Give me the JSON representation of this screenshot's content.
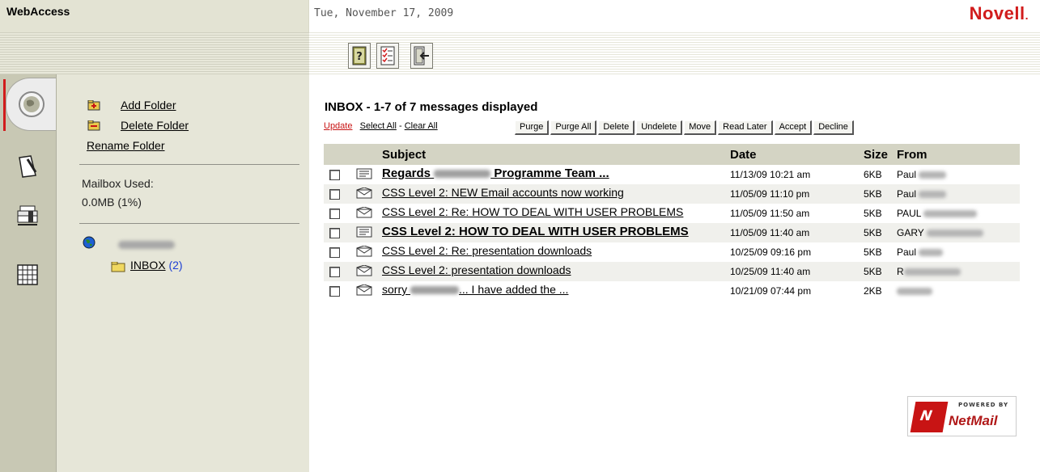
{
  "header": {
    "app_title": "WebAccess",
    "date": "Tue, November 17, 2009",
    "brand": "Novell",
    "brand_dot": ".",
    "toolbar": [
      "help-icon",
      "tasks-icon",
      "exit-icon"
    ]
  },
  "nav": {
    "items": [
      "mail-icon",
      "notes-icon",
      "address-book-icon",
      "calendar-icon"
    ]
  },
  "folders": {
    "add_label": "Add Folder",
    "delete_label": "Delete Folder",
    "rename_label": "Rename Folder",
    "mailbox_used_label": "Mailbox Used:",
    "mailbox_used_value": "0.0MB  (1%)",
    "inbox_name": "INBOX",
    "inbox_count": "(2)"
  },
  "main": {
    "heading": "INBOX - 1-7 of 7 messages displayed",
    "update": "Update",
    "select_all": "Select All",
    "sep": "-",
    "clear_all": "Clear All",
    "buttons": [
      "Purge",
      "Purge All",
      "Delete",
      "Undelete",
      "Move",
      "Read Later",
      "Accept",
      "Decline"
    ],
    "columns": {
      "subject": "Subject",
      "date": "Date",
      "size": "Size",
      "from": "From"
    },
    "messages": [
      {
        "subject_a": "Regards ",
        "subject_b": " Programme Team ...",
        "date": "11/13/09  10:21 am",
        "size": "6KB",
        "from": "Paul",
        "unread": true
      },
      {
        "subject": "CSS Level 2: NEW Email accounts now working",
        "date": "11/05/09  11:10 pm",
        "size": "5KB",
        "from": "Paul",
        "unread": false
      },
      {
        "subject": "CSS Level 2: Re: HOW TO DEAL WITH USER PROBLEMS",
        "date": "11/05/09  11:50 am",
        "size": "5KB",
        "from": "PAUL",
        "unread": false
      },
      {
        "subject": "CSS Level 2: HOW TO DEAL WITH USER PROBLEMS",
        "date": "11/05/09  11:40 am",
        "size": "5KB",
        "from": "GARY",
        "unread": true
      },
      {
        "subject": "CSS Level 2: Re: presentation downloads",
        "date": "10/25/09  09:16 pm",
        "size": "5KB",
        "from": "Paul",
        "unread": false
      },
      {
        "subject": "CSS Level 2: presentation downloads",
        "date": "10/25/09  11:40 am",
        "size": "5KB",
        "from": "R",
        "unread": false
      },
      {
        "subject_a": "sorry ",
        "subject_b": "... I have added the ...",
        "date": "10/21/09  07:44 pm",
        "size": "2KB",
        "from": "",
        "unread": false
      }
    ],
    "badge": {
      "powered": "POWERED BY",
      "name": "NetMail"
    }
  },
  "colors": {
    "accent_red": "#d11c1c",
    "count_blue": "#1e40d4",
    "panel": "#e6e6d8",
    "nav": "#c8c8b4"
  }
}
